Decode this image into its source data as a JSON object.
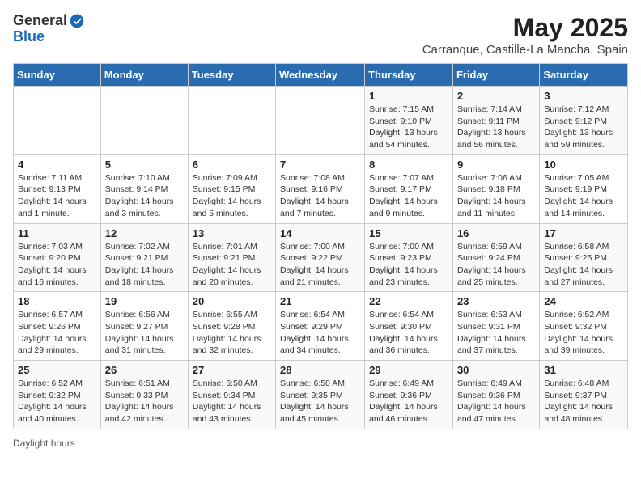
{
  "header": {
    "logo_general": "General",
    "logo_blue": "Blue",
    "month_year": "May 2025",
    "location": "Carranque, Castille-La Mancha, Spain"
  },
  "days_of_week": [
    "Sunday",
    "Monday",
    "Tuesday",
    "Wednesday",
    "Thursday",
    "Friday",
    "Saturday"
  ],
  "weeks": [
    [
      {
        "day": "",
        "info": ""
      },
      {
        "day": "",
        "info": ""
      },
      {
        "day": "",
        "info": ""
      },
      {
        "day": "",
        "info": ""
      },
      {
        "day": "1",
        "info": "Sunrise: 7:15 AM\nSunset: 9:10 PM\nDaylight: 13 hours\nand 54 minutes."
      },
      {
        "day": "2",
        "info": "Sunrise: 7:14 AM\nSunset: 9:11 PM\nDaylight: 13 hours\nand 56 minutes."
      },
      {
        "day": "3",
        "info": "Sunrise: 7:12 AM\nSunset: 9:12 PM\nDaylight: 13 hours\nand 59 minutes."
      }
    ],
    [
      {
        "day": "4",
        "info": "Sunrise: 7:11 AM\nSunset: 9:13 PM\nDaylight: 14 hours\nand 1 minute."
      },
      {
        "day": "5",
        "info": "Sunrise: 7:10 AM\nSunset: 9:14 PM\nDaylight: 14 hours\nand 3 minutes."
      },
      {
        "day": "6",
        "info": "Sunrise: 7:09 AM\nSunset: 9:15 PM\nDaylight: 14 hours\nand 5 minutes."
      },
      {
        "day": "7",
        "info": "Sunrise: 7:08 AM\nSunset: 9:16 PM\nDaylight: 14 hours\nand 7 minutes."
      },
      {
        "day": "8",
        "info": "Sunrise: 7:07 AM\nSunset: 9:17 PM\nDaylight: 14 hours\nand 9 minutes."
      },
      {
        "day": "9",
        "info": "Sunrise: 7:06 AM\nSunset: 9:18 PM\nDaylight: 14 hours\nand 11 minutes."
      },
      {
        "day": "10",
        "info": "Sunrise: 7:05 AM\nSunset: 9:19 PM\nDaylight: 14 hours\nand 14 minutes."
      }
    ],
    [
      {
        "day": "11",
        "info": "Sunrise: 7:03 AM\nSunset: 9:20 PM\nDaylight: 14 hours\nand 16 minutes."
      },
      {
        "day": "12",
        "info": "Sunrise: 7:02 AM\nSunset: 9:21 PM\nDaylight: 14 hours\nand 18 minutes."
      },
      {
        "day": "13",
        "info": "Sunrise: 7:01 AM\nSunset: 9:21 PM\nDaylight: 14 hours\nand 20 minutes."
      },
      {
        "day": "14",
        "info": "Sunrise: 7:00 AM\nSunset: 9:22 PM\nDaylight: 14 hours\nand 21 minutes."
      },
      {
        "day": "15",
        "info": "Sunrise: 7:00 AM\nSunset: 9:23 PM\nDaylight: 14 hours\nand 23 minutes."
      },
      {
        "day": "16",
        "info": "Sunrise: 6:59 AM\nSunset: 9:24 PM\nDaylight: 14 hours\nand 25 minutes."
      },
      {
        "day": "17",
        "info": "Sunrise: 6:58 AM\nSunset: 9:25 PM\nDaylight: 14 hours\nand 27 minutes."
      }
    ],
    [
      {
        "day": "18",
        "info": "Sunrise: 6:57 AM\nSunset: 9:26 PM\nDaylight: 14 hours\nand 29 minutes."
      },
      {
        "day": "19",
        "info": "Sunrise: 6:56 AM\nSunset: 9:27 PM\nDaylight: 14 hours\nand 31 minutes."
      },
      {
        "day": "20",
        "info": "Sunrise: 6:55 AM\nSunset: 9:28 PM\nDaylight: 14 hours\nand 32 minutes."
      },
      {
        "day": "21",
        "info": "Sunrise: 6:54 AM\nSunset: 9:29 PM\nDaylight: 14 hours\nand 34 minutes."
      },
      {
        "day": "22",
        "info": "Sunrise: 6:54 AM\nSunset: 9:30 PM\nDaylight: 14 hours\nand 36 minutes."
      },
      {
        "day": "23",
        "info": "Sunrise: 6:53 AM\nSunset: 9:31 PM\nDaylight: 14 hours\nand 37 minutes."
      },
      {
        "day": "24",
        "info": "Sunrise: 6:52 AM\nSunset: 9:32 PM\nDaylight: 14 hours\nand 39 minutes."
      }
    ],
    [
      {
        "day": "25",
        "info": "Sunrise: 6:52 AM\nSunset: 9:32 PM\nDaylight: 14 hours\nand 40 minutes."
      },
      {
        "day": "26",
        "info": "Sunrise: 6:51 AM\nSunset: 9:33 PM\nDaylight: 14 hours\nand 42 minutes."
      },
      {
        "day": "27",
        "info": "Sunrise: 6:50 AM\nSunset: 9:34 PM\nDaylight: 14 hours\nand 43 minutes."
      },
      {
        "day": "28",
        "info": "Sunrise: 6:50 AM\nSunset: 9:35 PM\nDaylight: 14 hours\nand 45 minutes."
      },
      {
        "day": "29",
        "info": "Sunrise: 6:49 AM\nSunset: 9:36 PM\nDaylight: 14 hours\nand 46 minutes."
      },
      {
        "day": "30",
        "info": "Sunrise: 6:49 AM\nSunset: 9:36 PM\nDaylight: 14 hours\nand 47 minutes."
      },
      {
        "day": "31",
        "info": "Sunrise: 6:48 AM\nSunset: 9:37 PM\nDaylight: 14 hours\nand 48 minutes."
      }
    ]
  ],
  "footer": {
    "daylight_hours": "Daylight hours"
  }
}
